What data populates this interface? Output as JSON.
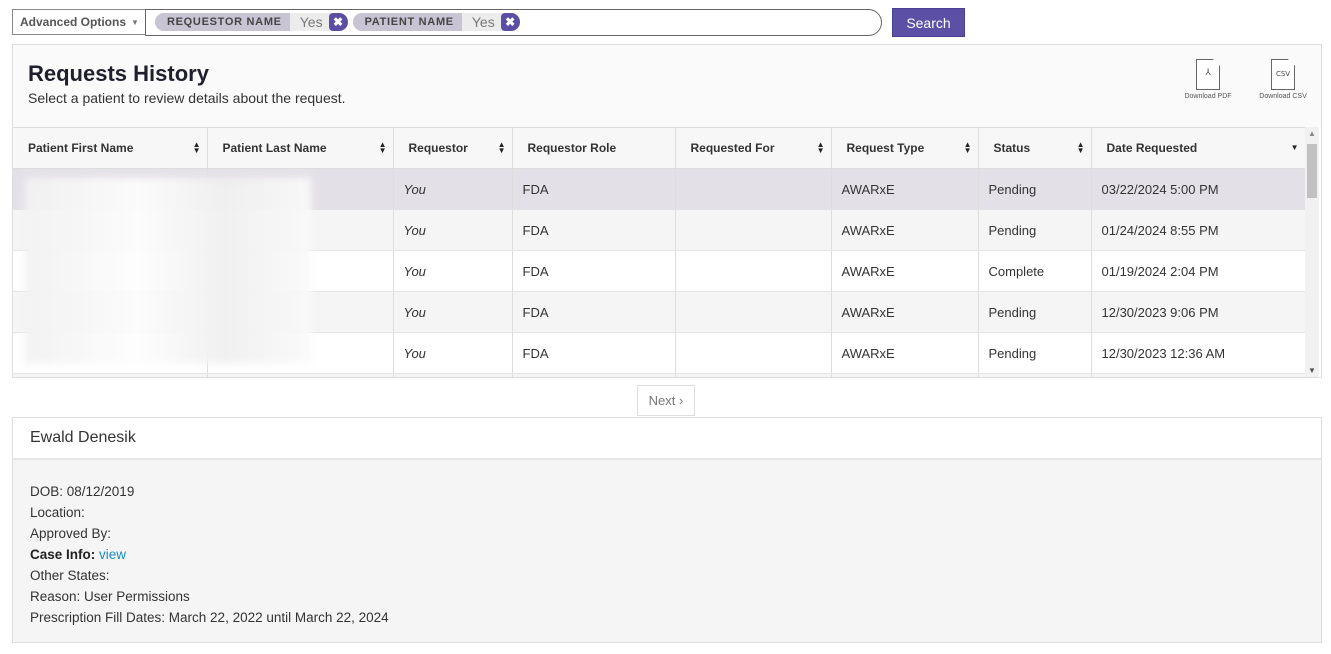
{
  "search": {
    "advanced_label": "Advanced Options",
    "chips": [
      {
        "name": "REQUESTOR NAME",
        "value": "Yes"
      },
      {
        "name": "PATIENT NAME",
        "value": "Yes"
      }
    ],
    "button_label": "Search"
  },
  "panel": {
    "title": "Requests History",
    "subtitle": "Select a patient to review details about the request.",
    "download_pdf": "Download PDF",
    "download_csv": "Download CSV",
    "pdf_glyph": "⅄",
    "csv_glyph": "CSV"
  },
  "table": {
    "columns": [
      "Patient First Name",
      "Patient Last Name",
      "Requestor",
      "Requestor Role",
      "Requested For",
      "Request Type",
      "Status",
      "Date Requested"
    ],
    "rows": [
      {
        "requestor": "You",
        "role": "FDA",
        "requested_for": "",
        "type": "AWARxE",
        "status": "Pending",
        "date": "03/22/2024 5:00 PM"
      },
      {
        "requestor": "You",
        "role": "FDA",
        "requested_for": "",
        "type": "AWARxE",
        "status": "Pending",
        "date": "01/24/2024 8:55 PM"
      },
      {
        "requestor": "You",
        "role": "FDA",
        "requested_for": "",
        "type": "AWARxE",
        "status": "Complete",
        "date": "01/19/2024 2:04 PM"
      },
      {
        "requestor": "You",
        "role": "FDA",
        "requested_for": "",
        "type": "AWARxE",
        "status": "Pending",
        "date": "12/30/2023 9:06 PM"
      },
      {
        "requestor": "You",
        "role": "FDA",
        "requested_for": "",
        "type": "AWARxE",
        "status": "Pending",
        "date": "12/30/2023 12:36 AM"
      }
    ]
  },
  "pager": {
    "next_label": "Next ›"
  },
  "detail": {
    "name": "Ewald Denesik",
    "dob": "DOB: 08/12/2019",
    "location": "Location:",
    "approved_by": "Approved By:",
    "case_info_label": "Case Info:",
    "case_info_link": "view",
    "other_states": "Other States:",
    "reason": "Reason: User Permissions",
    "fill_dates": "Prescription Fill Dates: March 22, 2022 until March 22, 2024"
  },
  "colors": {
    "accent": "#5b50a6",
    "link": "#1a8bc7",
    "selected_row": "#e4e0e8"
  }
}
